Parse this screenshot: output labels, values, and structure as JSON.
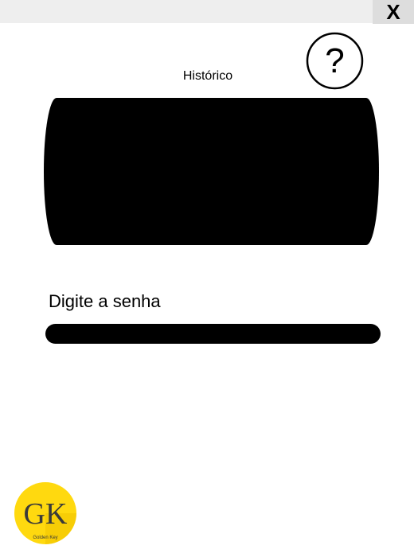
{
  "window": {
    "close_label": "X"
  },
  "help": {
    "icon": "question-circle-icon",
    "glyph": "?"
  },
  "history": {
    "label": "Histórico"
  },
  "password": {
    "label": "Digite a senha",
    "value": ""
  },
  "logo": {
    "mark": "GK",
    "text": "Golden Key",
    "accent_color": "#ffd90f"
  }
}
